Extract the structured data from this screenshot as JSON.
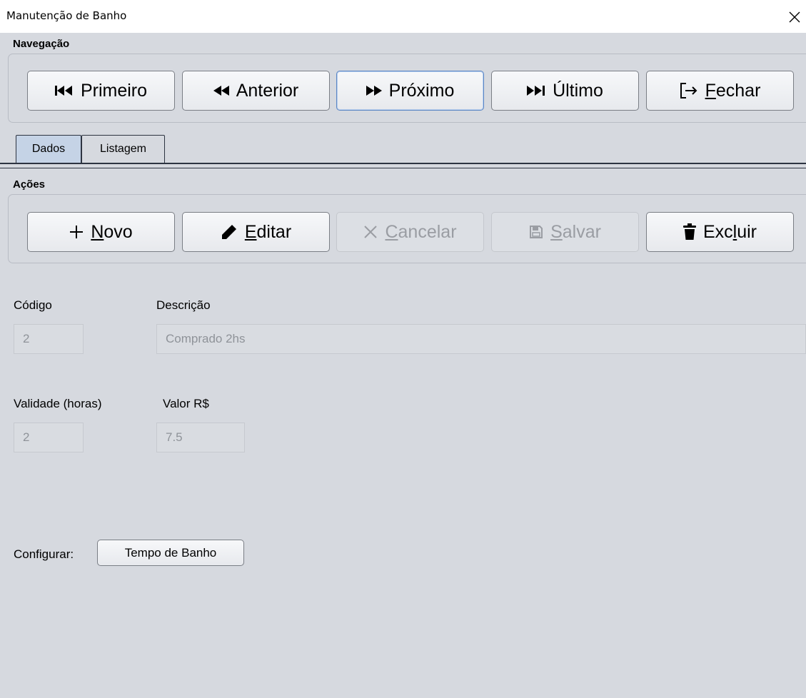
{
  "window": {
    "title": "Manutenção de Banho"
  },
  "navigation": {
    "group_label": "Navegação",
    "buttons": [
      {
        "label": "Primeiro",
        "icon": "skip-first-icon"
      },
      {
        "label": "Anterior",
        "icon": "rewind-icon"
      },
      {
        "label": "Próximo",
        "icon": "fast-forward-icon"
      },
      {
        "label": "Último",
        "icon": "skip-last-icon"
      },
      {
        "label_mnemonic": "F",
        "label_rest": "echar",
        "icon": "exit-icon"
      }
    ]
  },
  "tabs": [
    {
      "label": "Dados",
      "active": true
    },
    {
      "label": "Listagem",
      "active": false
    }
  ],
  "actions": {
    "group_label": "Ações",
    "buttons": [
      {
        "prefix": "+",
        "mnemonic": "N",
        "rest": "ovo",
        "icon": "plus-icon",
        "enabled": true
      },
      {
        "mnemonic": "E",
        "rest": "ditar",
        "icon": "pencil-icon",
        "enabled": true
      },
      {
        "mnemonic": "C",
        "rest": "ancelar",
        "icon": "x-icon",
        "enabled": false
      },
      {
        "mnemonic": "S",
        "rest": "alvar",
        "icon": "floppy-icon",
        "enabled": false
      },
      {
        "before": "Exc",
        "mnemonic": "l",
        "rest": "uir",
        "icon": "trash-icon",
        "enabled": true
      }
    ]
  },
  "form": {
    "codigo": {
      "label": "Código",
      "value": "2"
    },
    "descricao": {
      "label": "Descrição",
      "value": "Comprado 2hs"
    },
    "validade": {
      "label": "Validade (horas)",
      "value": "2"
    },
    "valor": {
      "label": "Valor R$",
      "value": "7.5"
    }
  },
  "configurar": {
    "label": "Configurar:",
    "button_label": "Tempo de Banho"
  }
}
